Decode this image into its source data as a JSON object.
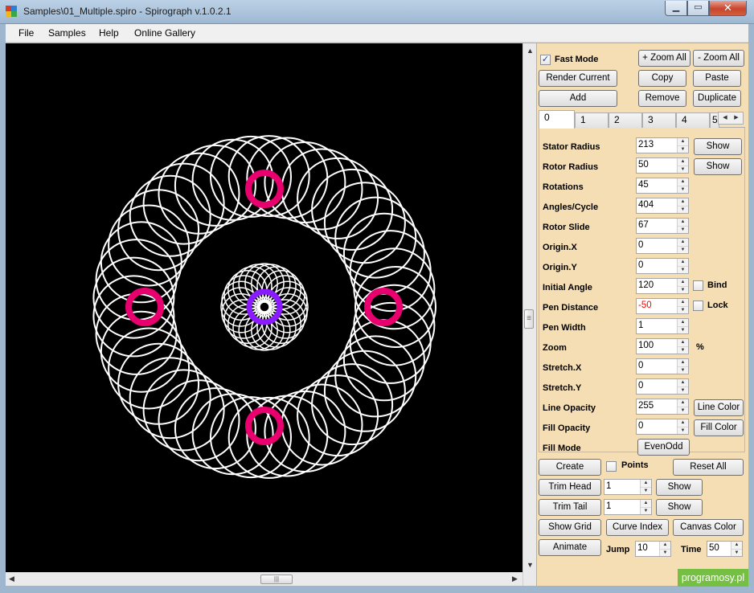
{
  "window": {
    "title": "Samples\\01_Multiple.spiro - Spirograph v.1.0.2.1",
    "minimize": "▁",
    "maximize": "▭",
    "close": "✕"
  },
  "menu": [
    "File",
    "Samples",
    "Help",
    "Online Gallery"
  ],
  "colors": {
    "panel_bg": "#f5deb3",
    "canvas_bg": "#000000",
    "curve": "#ffffff",
    "rotor_marker": "#e8006e",
    "center_marker": "#8a1aff",
    "pen_distance_text": "#ff0000",
    "badge": "#75c043"
  },
  "toolbar": {
    "fast_mode_label": "Fast Mode",
    "fast_mode_checked": true,
    "zoom_all_plus": "+ Zoom All",
    "zoom_all_minus": "- Zoom All",
    "render_current": "Render Current",
    "copy": "Copy",
    "paste": "Paste",
    "add": "Add",
    "remove": "Remove",
    "duplicate": "Duplicate"
  },
  "tabs": [
    "0",
    "1",
    "2",
    "3",
    "4",
    "5"
  ],
  "params": {
    "stator_radius": {
      "label": "Stator Radius",
      "value": "213"
    },
    "rotor_radius": {
      "label": "Rotor Radius",
      "value": "50"
    },
    "rotations": {
      "label": "Rotations",
      "value": "45"
    },
    "angles_cycle": {
      "label": "Angles/Cycle",
      "value": "404"
    },
    "rotor_slide": {
      "label": "Rotor Slide",
      "value": "67"
    },
    "origin_x": {
      "label": "Origin.X",
      "value": "0"
    },
    "origin_y": {
      "label": "Origin.Y",
      "value": "0"
    },
    "initial_angle": {
      "label": "Initial Angle",
      "value": "120"
    },
    "pen_distance": {
      "label": "Pen Distance",
      "value": "-50"
    },
    "pen_width": {
      "label": "Pen Width",
      "value": "1"
    },
    "zoom": {
      "label": "Zoom",
      "value": "100",
      "unit": "%"
    },
    "stretch_x": {
      "label": "Stretch.X",
      "value": "0"
    },
    "stretch_y": {
      "label": "Stretch.Y",
      "value": "0"
    },
    "line_opacity": {
      "label": "Line Opacity",
      "value": "255"
    },
    "fill_opacity": {
      "label": "Fill Opacity",
      "value": "0"
    },
    "fill_mode": {
      "label": "Fill Mode",
      "value": "EvenOdd"
    }
  },
  "param_buttons": {
    "show_stator": "Show",
    "show_rotor": "Show",
    "bind": "Bind",
    "lock": "Lock",
    "line_color": "Line Color",
    "fill_color": "Fill Color"
  },
  "actions": {
    "create": "Create",
    "points": "Points",
    "reset_all": "Reset All",
    "trim_head": "Trim Head",
    "trim_head_value": "1",
    "trim_head_show": "Show",
    "trim_tail": "Trim Tail",
    "trim_tail_value": "1",
    "trim_tail_show": "Show",
    "show_grid": "Show Grid",
    "curve_index": "Curve Index",
    "canvas_color": "Canvas Color",
    "animate": "Animate",
    "jump_label": "Jump",
    "jump_value": "10",
    "time_label": "Time",
    "time_value": "50"
  },
  "badge": "programosy.pl"
}
